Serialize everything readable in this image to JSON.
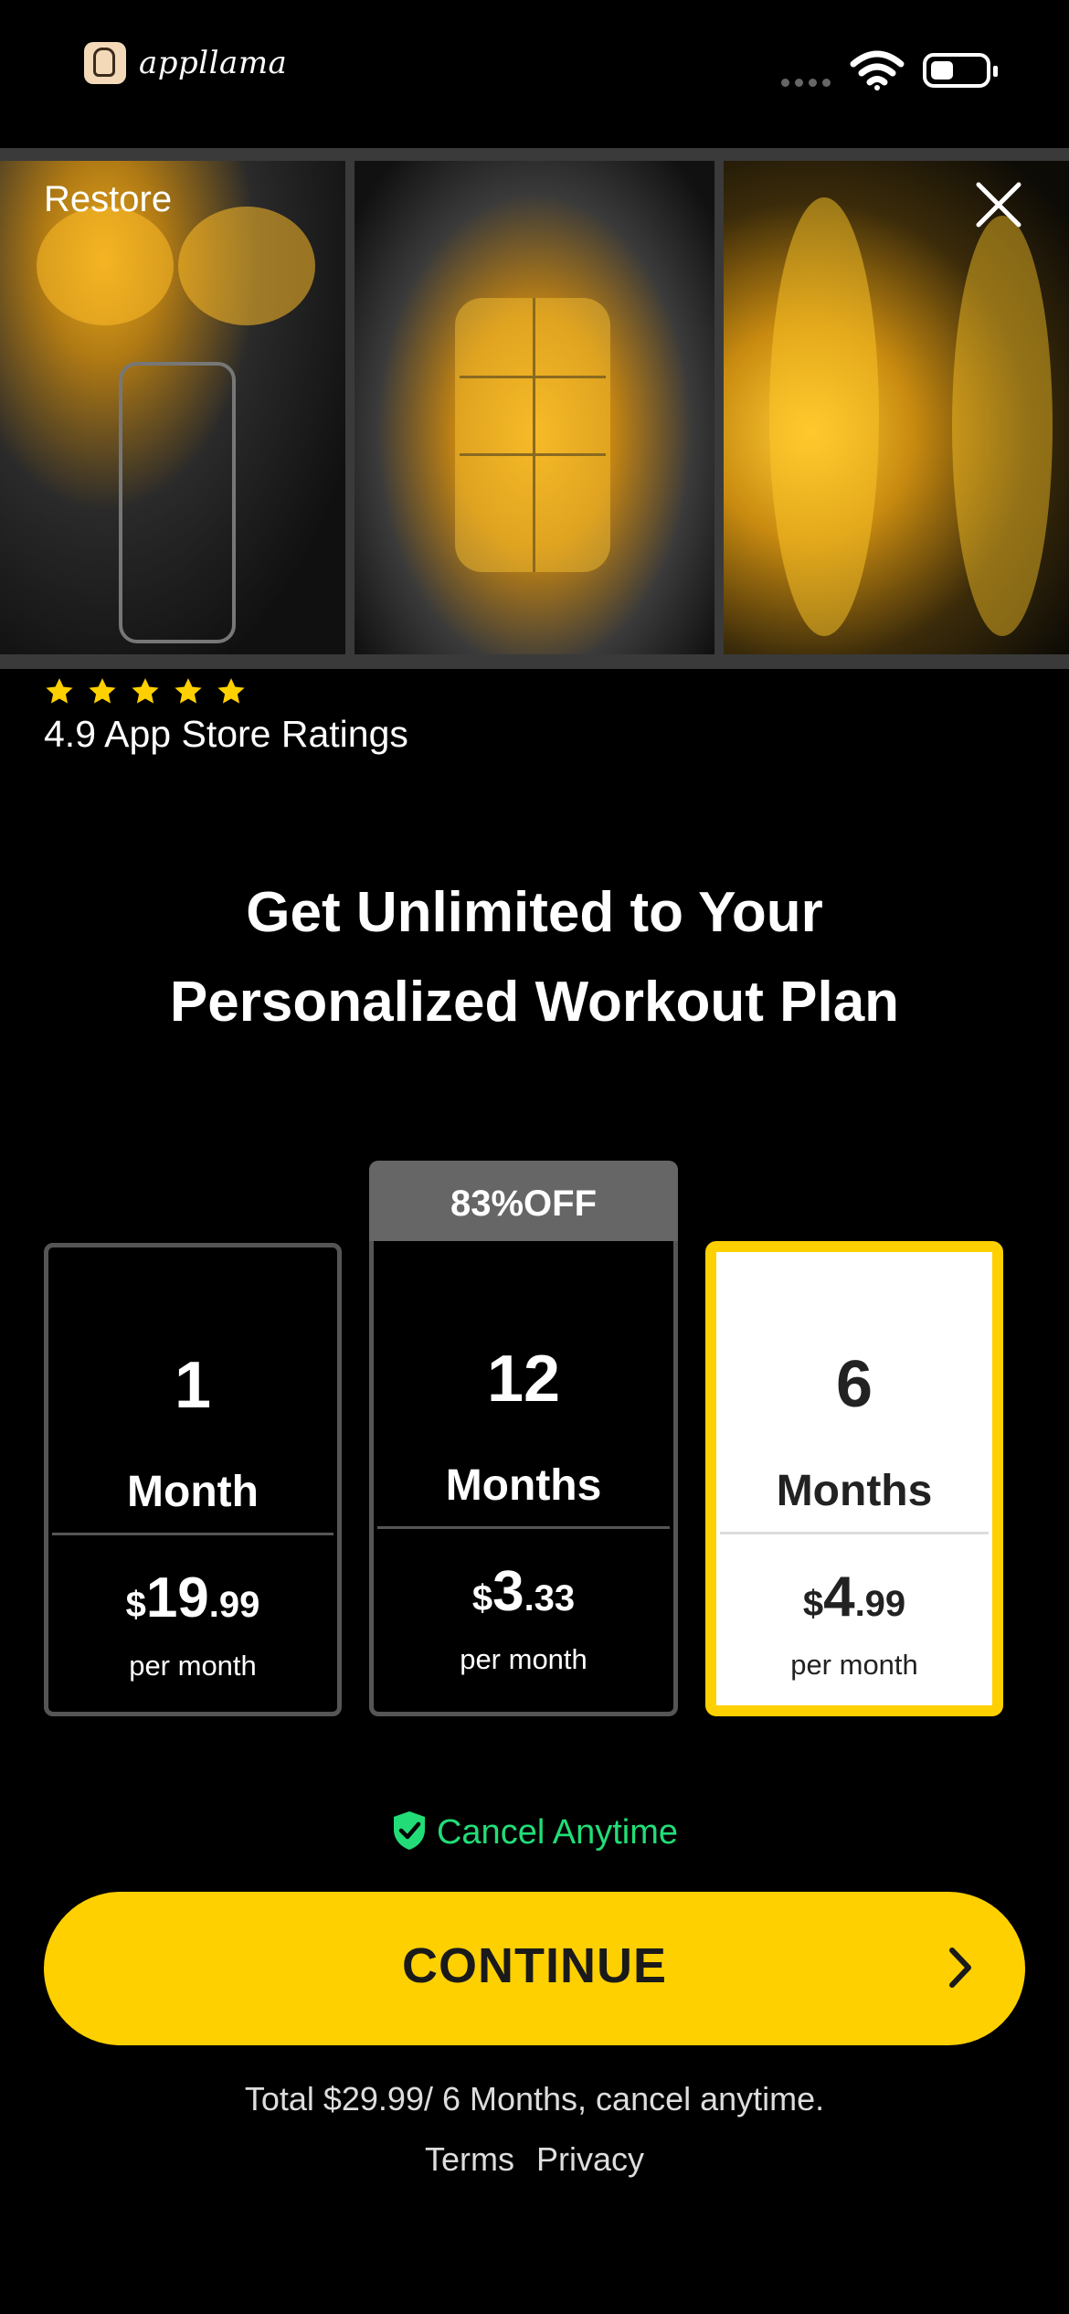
{
  "status_bar": {
    "app_logo_text": "appllama",
    "icons": [
      "signal-dots-icon",
      "wifi-icon",
      "battery-icon"
    ]
  },
  "hero": {
    "restore_label": "Restore",
    "close_icon": "close-icon",
    "images": [
      "chest-muscles-image",
      "abs-muscles-image",
      "leg-muscles-image"
    ]
  },
  "rating": {
    "stars": 5,
    "text": "4.9 App Store Ratings",
    "star_color": "#ffd000"
  },
  "headline": {
    "line1": "Get Unlimited to Your",
    "line2": "Personalized Workout Plan"
  },
  "plans": [
    {
      "number": "1",
      "unit": "Month",
      "currency": "$",
      "price_whole": "19",
      "price_cents": ".99",
      "per": "per month",
      "selected": false
    },
    {
      "badge": "83%OFF",
      "number": "12",
      "unit": "Months",
      "currency": "$",
      "price_whole": "3",
      "price_cents": ".33",
      "per": "per month",
      "selected": false
    },
    {
      "number": "6",
      "unit": "Months",
      "currency": "$",
      "price_whole": "4",
      "price_cents": ".99",
      "per": "per month",
      "selected": true
    }
  ],
  "cancel_anytime": "Cancel Anytime",
  "continue_label": "CONTINUE",
  "footer": {
    "total_text": "Total $29.99/ 6 Months, cancel anytime.",
    "terms_label": "Terms",
    "privacy_label": "Privacy"
  },
  "colors": {
    "accent": "#ffd000",
    "cancel_green": "#22dd77",
    "background": "#000000"
  }
}
